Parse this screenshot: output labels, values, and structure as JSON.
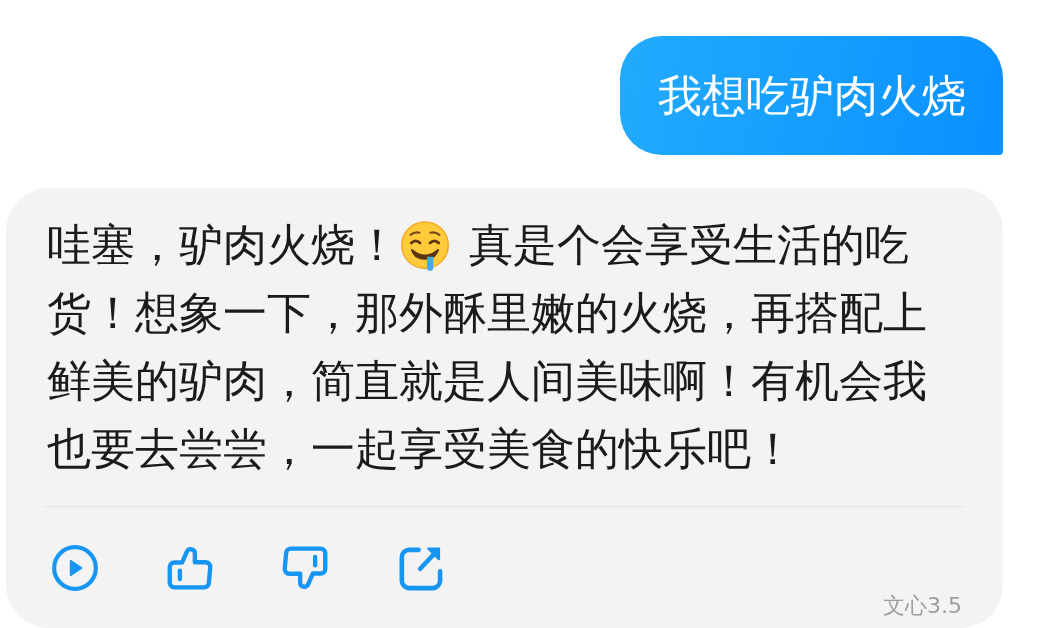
{
  "conversation": [
    {
      "kind": "user",
      "text": "我想吃驴肉火烧"
    },
    {
      "kind": "assistant",
      "parts": [
        {
          "kind": "text",
          "text": "哇塞，驴肉火烧！"
        },
        {
          "kind": "emoji"
        },
        {
          "kind": "text",
          "text": "真是个会享受生活的吃货！想象一下，那外酥里嫩的火烧，再搭配上鲜美的驴肉，简直就是人间美味啊！有机会我也要去尝尝，一起享受美食的快乐吧！"
        }
      ],
      "actions": [
        {
          "kind": "play"
        },
        {
          "kind": "thumbs_up"
        },
        {
          "kind": "thumbs_down"
        },
        {
          "kind": "share"
        }
      ],
      "model_label": "文心3.5"
    }
  ]
}
